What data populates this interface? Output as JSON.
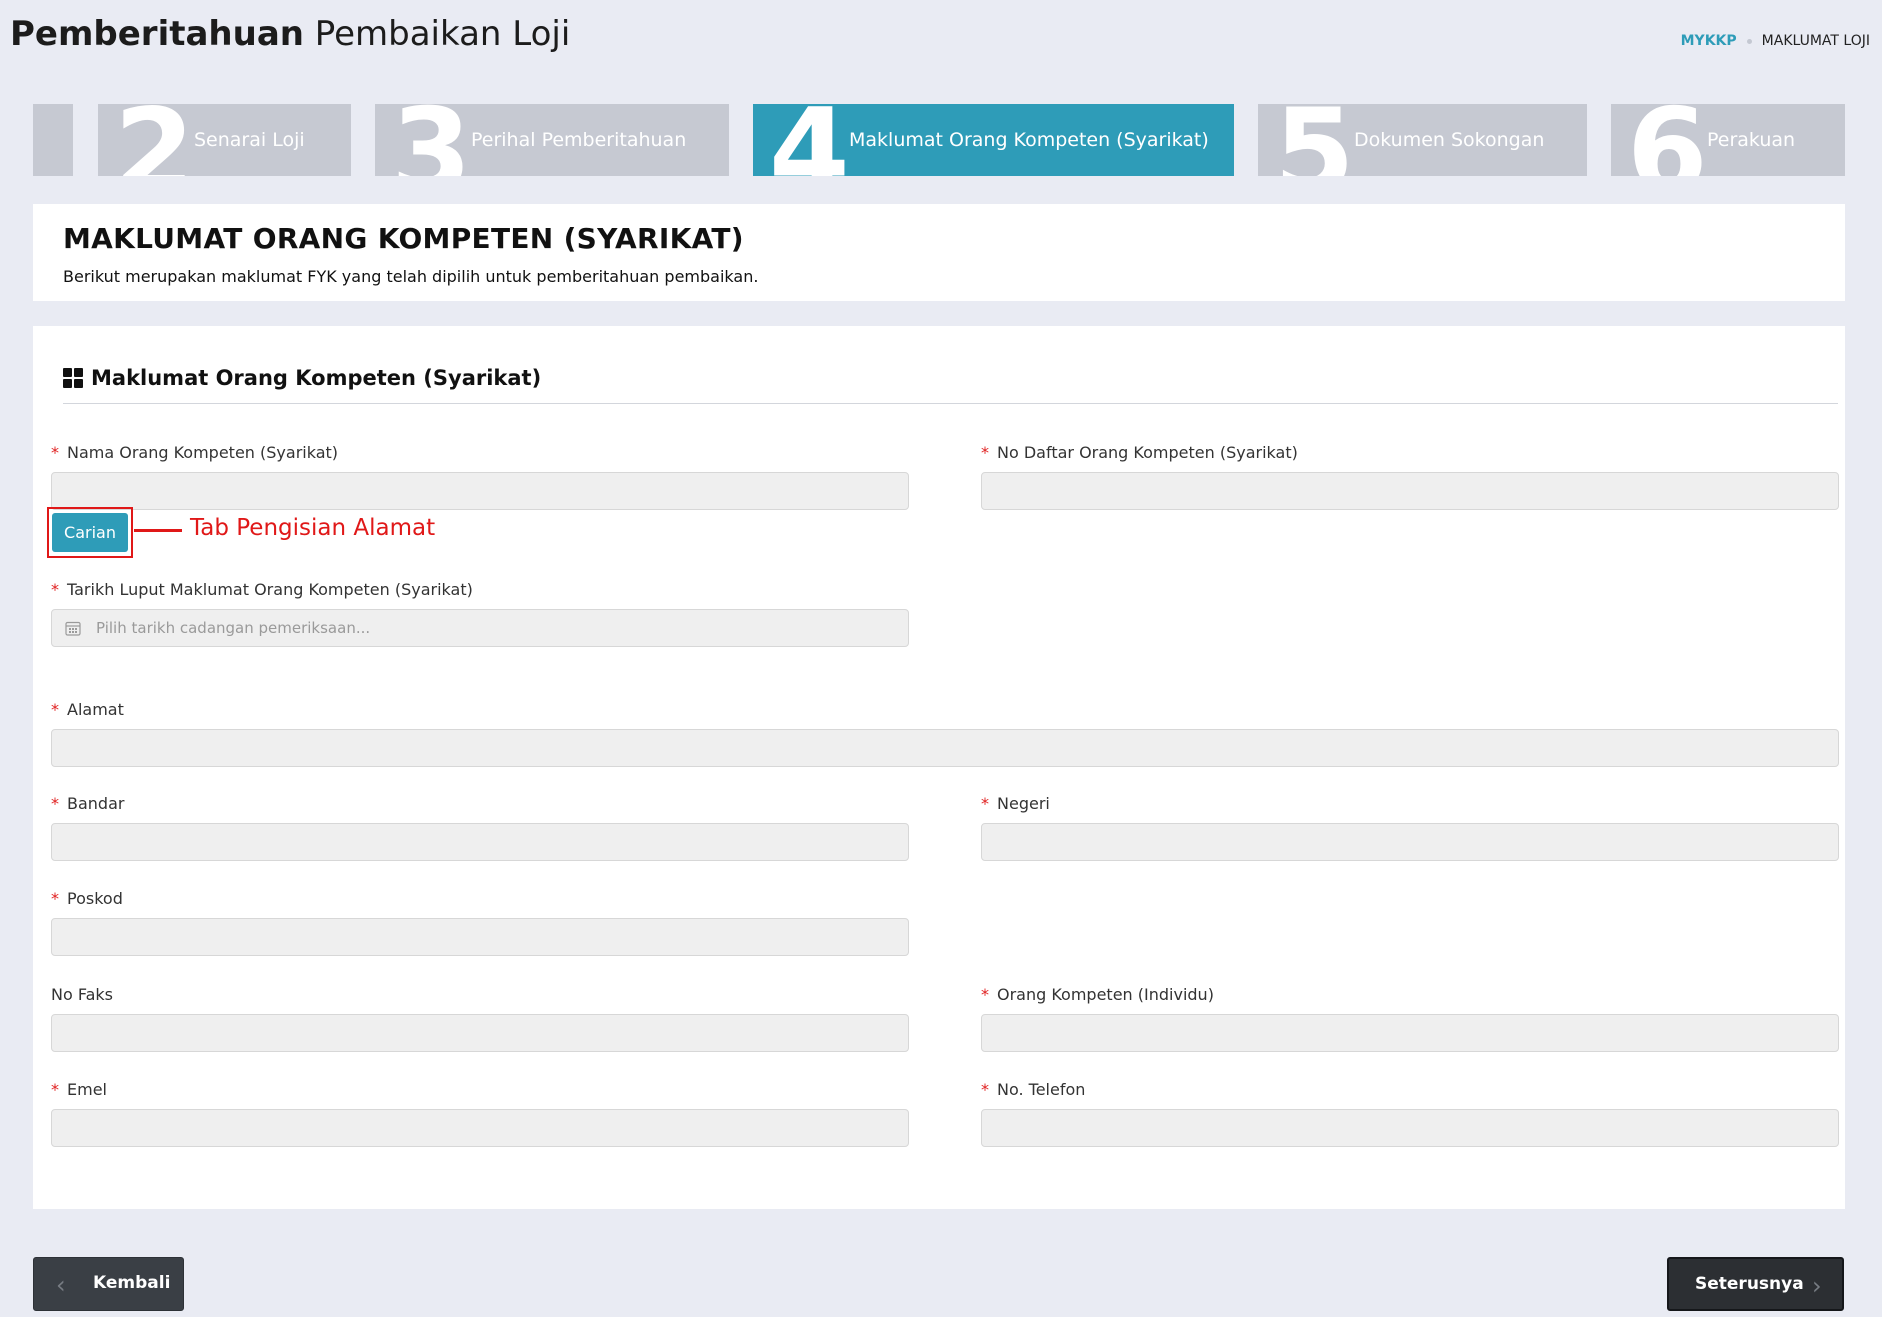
{
  "header": {
    "title_bold": "Pemberitahuan",
    "title_light": "Pembaikan Loji",
    "breadcrumb": {
      "link": "MYKKP",
      "current": "MAKLUMAT LOJI"
    }
  },
  "steps": [
    {
      "num": "2",
      "label": "Senarai Loji",
      "active": false
    },
    {
      "num": "3",
      "label": "Perihal Pemberitahuan",
      "active": false
    },
    {
      "num": "4",
      "label": "Maklumat Orang Kompeten (Syarikat)",
      "active": true
    },
    {
      "num": "5",
      "label": "Dokumen Sokongan",
      "active": false
    },
    {
      "num": "6",
      "label": "Perakuan",
      "active": false
    }
  ],
  "intro": {
    "title": "MAKLUMAT ORANG KOMPETEN (SYARIKAT)",
    "description": "Berikut merupakan maklumat FYK yang telah dipilih untuk pemberitahuan pembaikan."
  },
  "form": {
    "section_title": "Maklumat Orang Kompeten (Syarikat)",
    "required_marker": "*",
    "fields": {
      "nama": {
        "label": "Nama Orang Kompeten (Syarikat)",
        "value": ""
      },
      "no_daftar": {
        "label": "No Daftar Orang Kompeten (Syarikat)",
        "value": ""
      },
      "tarikh": {
        "label": "Tarikh Luput Maklumat Orang Kompeten (Syarikat)",
        "placeholder": "Pilih tarikh cadangan pemeriksaan..."
      },
      "alamat": {
        "label": "Alamat",
        "value": ""
      },
      "bandar": {
        "label": "Bandar",
        "value": ""
      },
      "negeri": {
        "label": "Negeri",
        "value": ""
      },
      "poskod": {
        "label": "Poskod",
        "value": ""
      },
      "no_faks": {
        "label": "No Faks",
        "value": ""
      },
      "orang_kompeten": {
        "label": "Orang Kompeten (Individu)",
        "value": ""
      },
      "emel": {
        "label": "Emel",
        "value": ""
      },
      "no_telefon": {
        "label": "No. Telefon",
        "value": ""
      }
    },
    "carian_button": "Carian",
    "annotation": "Tab Pengisian Alamat"
  },
  "nav": {
    "back": "Kembali",
    "next": "Seterusnya"
  },
  "colors": {
    "accent": "#2e9cb8",
    "step_inactive": "#c6c9d2",
    "annotation": "#e01818",
    "background": "#e9ebf3"
  }
}
